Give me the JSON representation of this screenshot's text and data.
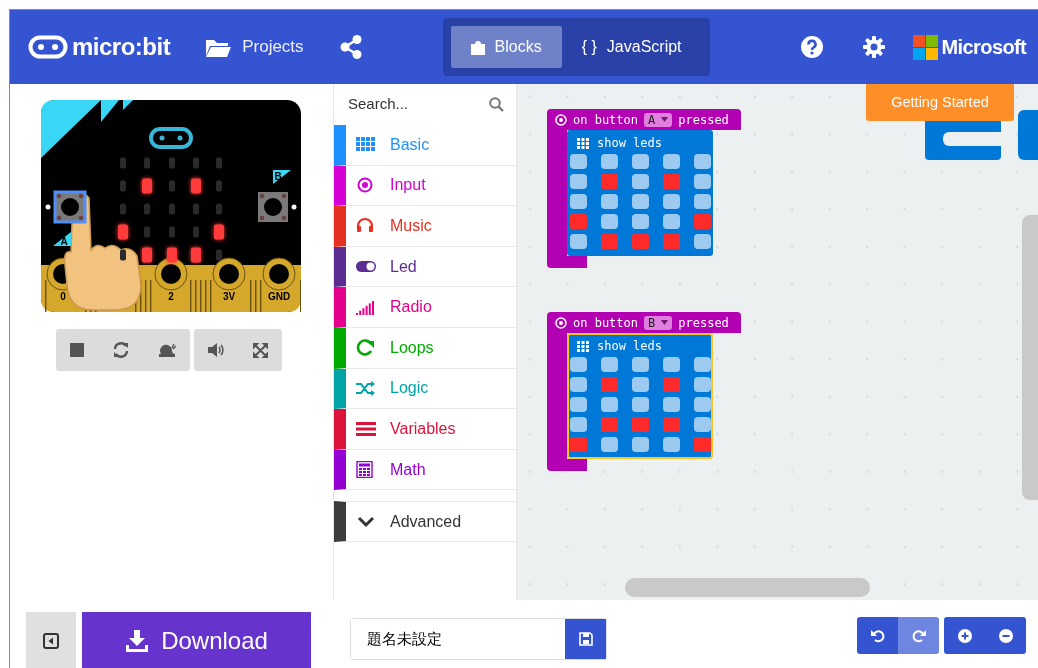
{
  "header": {
    "logo": "micro:bit",
    "projects": "Projects",
    "tabs": [
      {
        "label": "Blocks",
        "selected": true,
        "kind": "blocks"
      },
      {
        "label": "JavaScript",
        "selected": false,
        "kind": "code",
        "glyph": "{ }"
      }
    ],
    "brand": "Microsoft"
  },
  "simulator": {
    "leds": [
      [
        false,
        false,
        false,
        false,
        false
      ],
      [
        false,
        true,
        false,
        true,
        false
      ],
      [
        false,
        false,
        false,
        false,
        false
      ],
      [
        true,
        false,
        false,
        false,
        true
      ],
      [
        false,
        true,
        true,
        true,
        false
      ]
    ],
    "buttons": [
      {
        "label": "A",
        "pressed": true
      },
      {
        "label": "B",
        "pressed": false
      }
    ],
    "pins": [
      "0",
      "2",
      "3V",
      "GND"
    ]
  },
  "toolbox": {
    "search_placeholder": "Search...",
    "categories": [
      {
        "label": "Basic",
        "color": "#1e90ff"
      },
      {
        "label": "Input",
        "color": "#d400d4"
      },
      {
        "label": "Music",
        "color": "#e63022"
      },
      {
        "label": "Led",
        "color": "#5c2d91"
      },
      {
        "label": "Radio",
        "color": "#e3008c"
      },
      {
        "label": "Loops",
        "color": "#00aa00"
      },
      {
        "label": "Logic",
        "color": "#00a4a6"
      },
      {
        "label": "Variables",
        "color": "#dc143c"
      },
      {
        "label": "Math",
        "color": "#9400d3"
      }
    ],
    "advanced": "Advanced"
  },
  "workspace": {
    "getting_started": "Getting Started",
    "blocks": [
      {
        "event": "on button",
        "button": "A",
        "suffix": "pressed",
        "title": "show leds",
        "selected": false,
        "leds": [
          [
            false,
            false,
            false,
            false,
            false
          ],
          [
            false,
            true,
            false,
            true,
            false
          ],
          [
            false,
            false,
            false,
            false,
            false
          ],
          [
            true,
            false,
            false,
            false,
            true
          ],
          [
            false,
            true,
            true,
            true,
            false
          ]
        ]
      },
      {
        "event": "on button",
        "button": "B",
        "suffix": "pressed",
        "title": "show leds",
        "selected": true,
        "leds": [
          [
            false,
            false,
            false,
            false,
            false
          ],
          [
            false,
            true,
            false,
            true,
            false
          ],
          [
            false,
            false,
            false,
            false,
            false
          ],
          [
            false,
            true,
            true,
            true,
            false
          ],
          [
            true,
            false,
            false,
            false,
            true
          ]
        ]
      }
    ]
  },
  "bottom": {
    "download": "Download",
    "project_name": "題名未設定",
    "history": [
      {
        "kind": "undo",
        "disabled": false
      },
      {
        "kind": "redo",
        "disabled": true
      }
    ]
  }
}
